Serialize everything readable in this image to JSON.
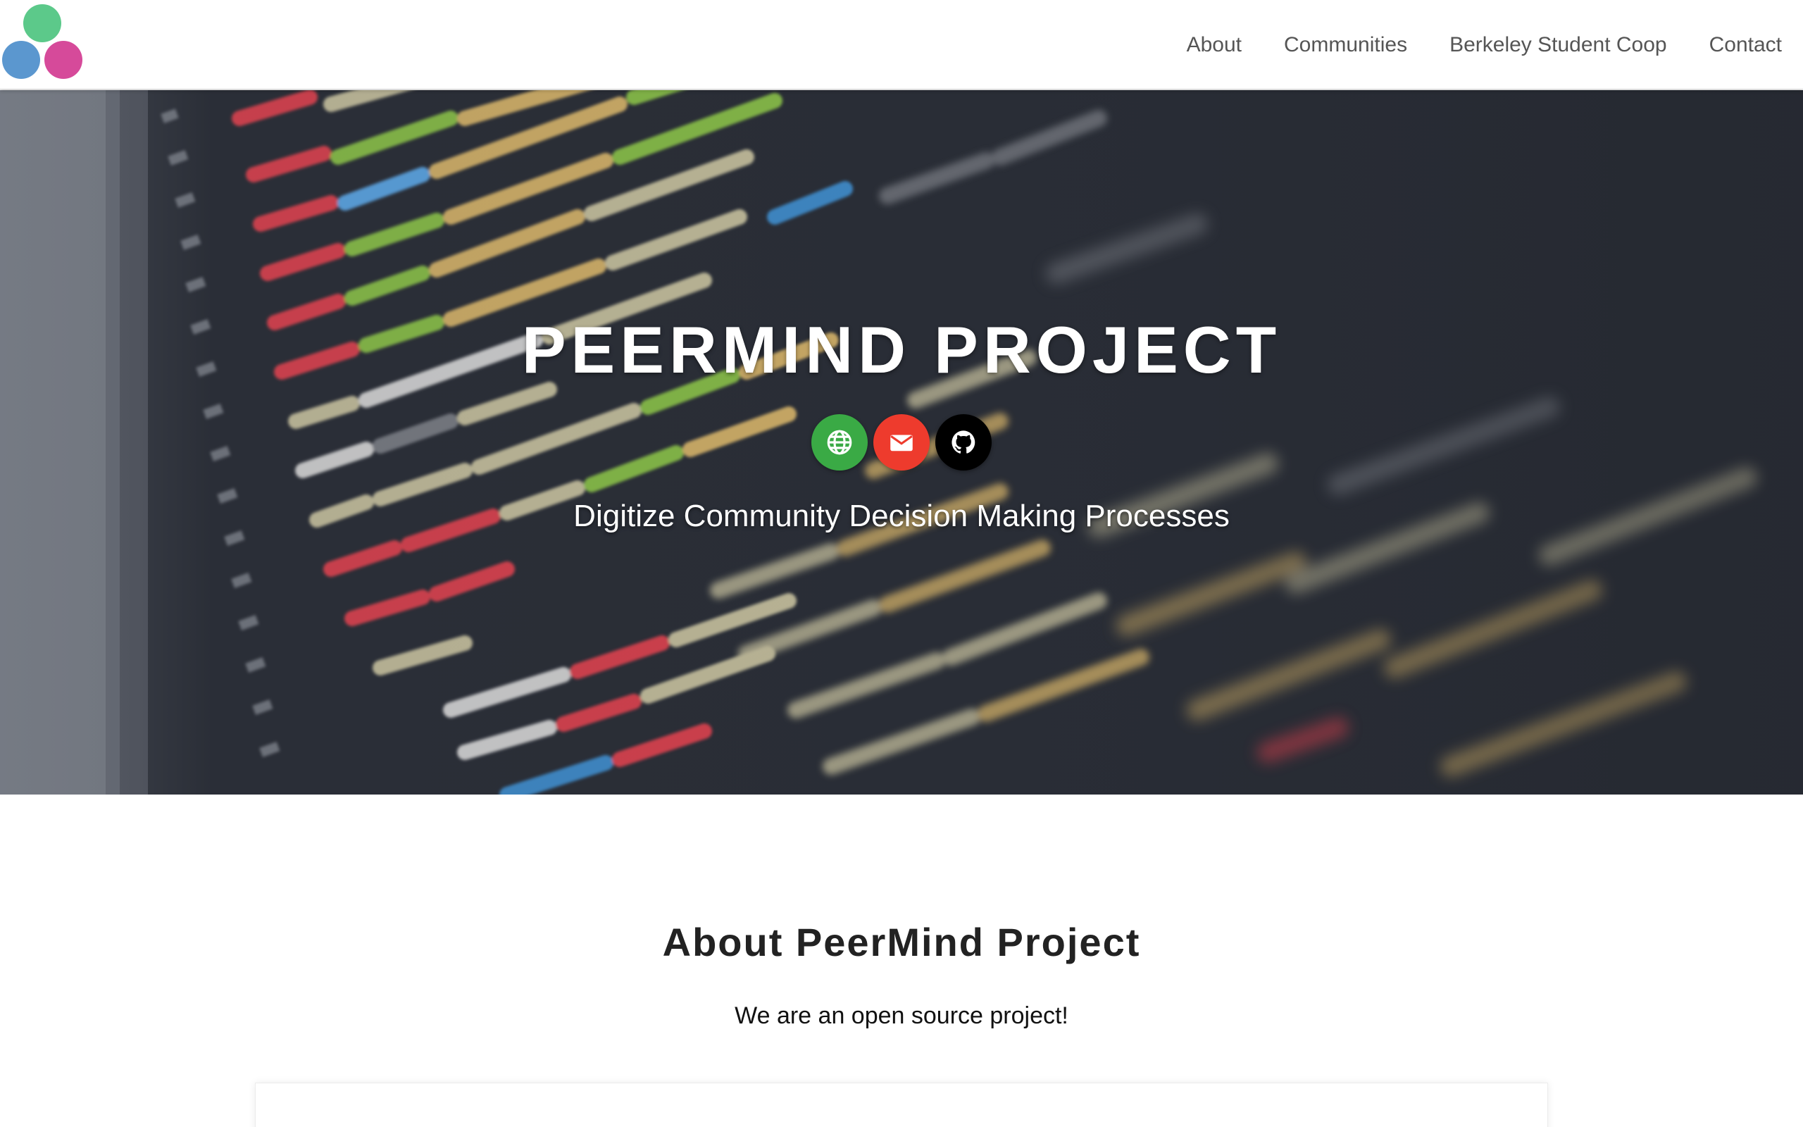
{
  "header": {
    "logo_name": "PeerMind logo",
    "nav": [
      {
        "label": "About"
      },
      {
        "label": "Communities"
      },
      {
        "label": "Berkeley Student Coop"
      },
      {
        "label": "Contact"
      }
    ]
  },
  "hero": {
    "title": "PEERMIND PROJECT",
    "subtitle": "Digitize Community Decision Making Processes",
    "icons": [
      {
        "name": "globe-icon",
        "color": "#3aaa45"
      },
      {
        "name": "email-icon",
        "color": "#ee3b2d"
      },
      {
        "name": "github-icon",
        "color": "#000000"
      }
    ]
  },
  "about": {
    "heading": "About PeerMind Project",
    "text": "We are an open source project!"
  },
  "colors": {
    "nav_text": "#555555",
    "hero_bg": "#2a2e37",
    "heading": "#222222",
    "logo_green": "#5cc98a",
    "logo_blue": "#5b97cf",
    "logo_pink": "#d64a9a"
  }
}
